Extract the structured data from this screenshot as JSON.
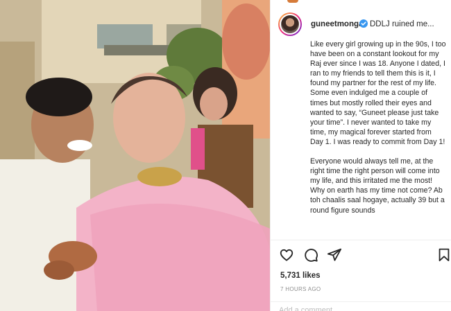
{
  "post": {
    "username": "guneetmonga",
    "caption_start": "DDLJ ruined me...",
    "caption_paragraphs": [
      "Like every girl growing up in the 90s, I too have been on a constant lookout for my Raj ever since I was 18. Anyone I dated, I ran to my friends to tell them this is it, I found my partner for the rest of my life. Some even indulged me a couple of times but mostly rolled their eyes and wanted to say, “Guneet please just take your time”. I never wanted to take my time, my magical forever started from Day 1. I was ready to commit from Day 1!",
      "Everyone would always tell me, at the right time the right person will come into my life, and this irritated me the most! Why on earth has my time not come? Ab toh chaalis saal hogaye, actually 39 but a round figure sounds"
    ],
    "likes": "5,731 likes",
    "timestamp": "7 HOURS AGO",
    "comment_placeholder": "Add a comment..."
  },
  "icons": {
    "verified": "verified-badge-icon",
    "like": "heart-icon",
    "comment": "comment-icon",
    "share": "share-icon",
    "save": "bookmark-icon"
  },
  "colors": {
    "verified_blue": "#3897f0",
    "text": "#262626",
    "muted": "#8e8e8e"
  }
}
